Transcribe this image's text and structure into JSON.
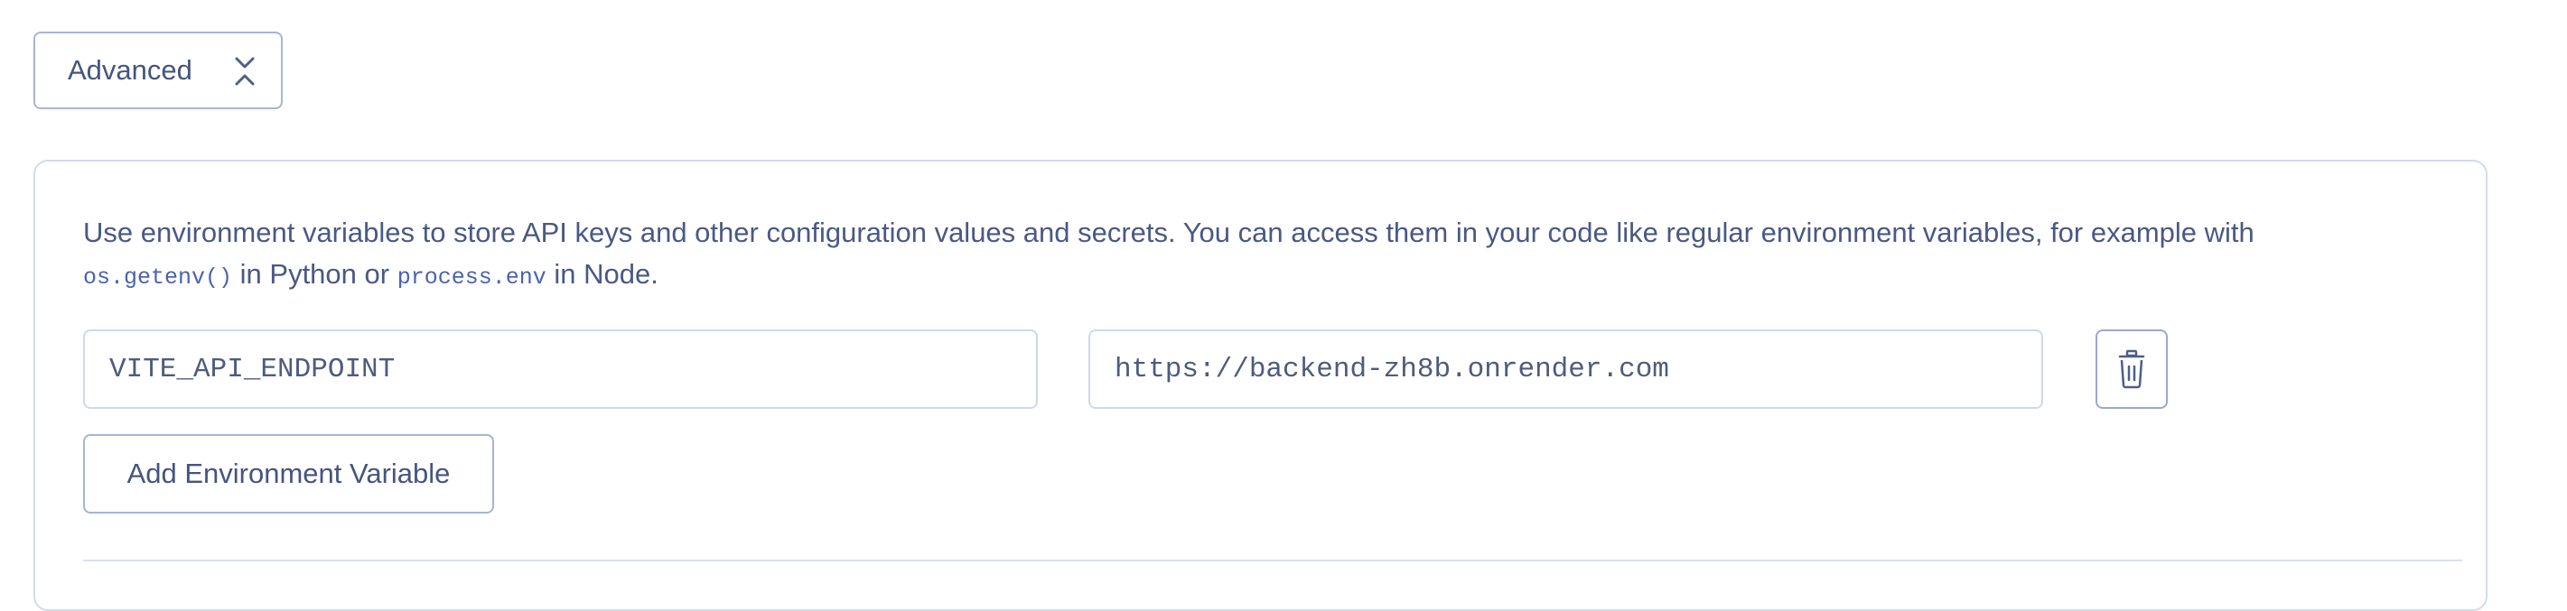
{
  "advanced": {
    "label": "Advanced"
  },
  "env_section": {
    "description_text": "Use environment variables to store API keys and other configuration values and secrets. You can access them in your code like regular environment variables, for example with",
    "python_code": "os.getenv()",
    "python_text": "in Python or",
    "node_code": "process.env",
    "node_text": "in Node.",
    "variables": [
      {
        "key": "VITE_API_ENDPOINT",
        "value": "https://backend-zh8b.onrender.com"
      }
    ],
    "add_label": "Add Environment Variable"
  }
}
